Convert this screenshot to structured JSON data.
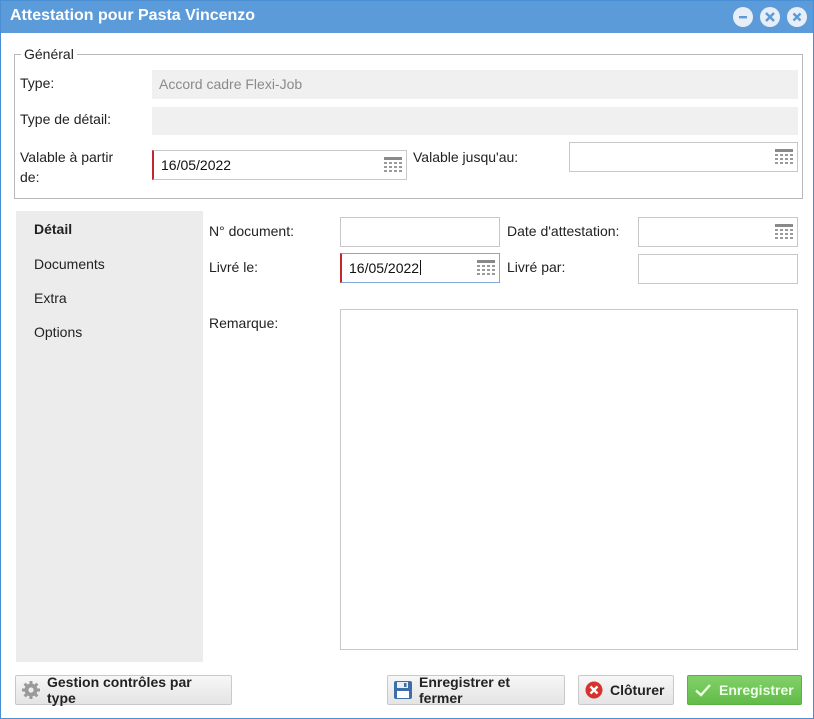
{
  "window": {
    "title": "Attestation pour Pasta Vincenzo",
    "controls": [
      "minimize-icon",
      "restore-icon",
      "close-icon"
    ]
  },
  "general": {
    "legend": "Général",
    "type_label": "Type:",
    "type_value": "Accord cadre Flexi-Job",
    "detail_type_label": "Type de détail:",
    "detail_type_value": "",
    "valid_from_label_line1": "Valable à partir",
    "valid_from_label_line2": "de:",
    "valid_from_value": "16/05/2022",
    "valid_until_label": "Valable jusqu'au:",
    "valid_until_value": ""
  },
  "sidenav": {
    "items": [
      {
        "label": "Détail",
        "active": true
      },
      {
        "label": "Documents",
        "active": false
      },
      {
        "label": "Extra",
        "active": false
      },
      {
        "label": "Options",
        "active": false
      }
    ]
  },
  "detail": {
    "document_no_label": "N° document:",
    "document_no_value": "",
    "attestation_date_label": "Date d'attestation:",
    "attestation_date_value": "",
    "delivered_on_label": "Livré le:",
    "delivered_on_value": "16/05/2022",
    "delivered_by_label": "Livré par:",
    "delivered_by_value": "",
    "remark_label": "Remarque:",
    "remark_value": ""
  },
  "footer": {
    "manage_controls_label": "Gestion contrôles par type",
    "save_close_label": "Enregistrer et fermer",
    "close_record_label": "Clôturer",
    "save_label": "Enregistrer"
  },
  "colors": {
    "titlebar": "#5b9bd9",
    "required_marker": "#c0282d",
    "primary_button": "#6ac150"
  }
}
